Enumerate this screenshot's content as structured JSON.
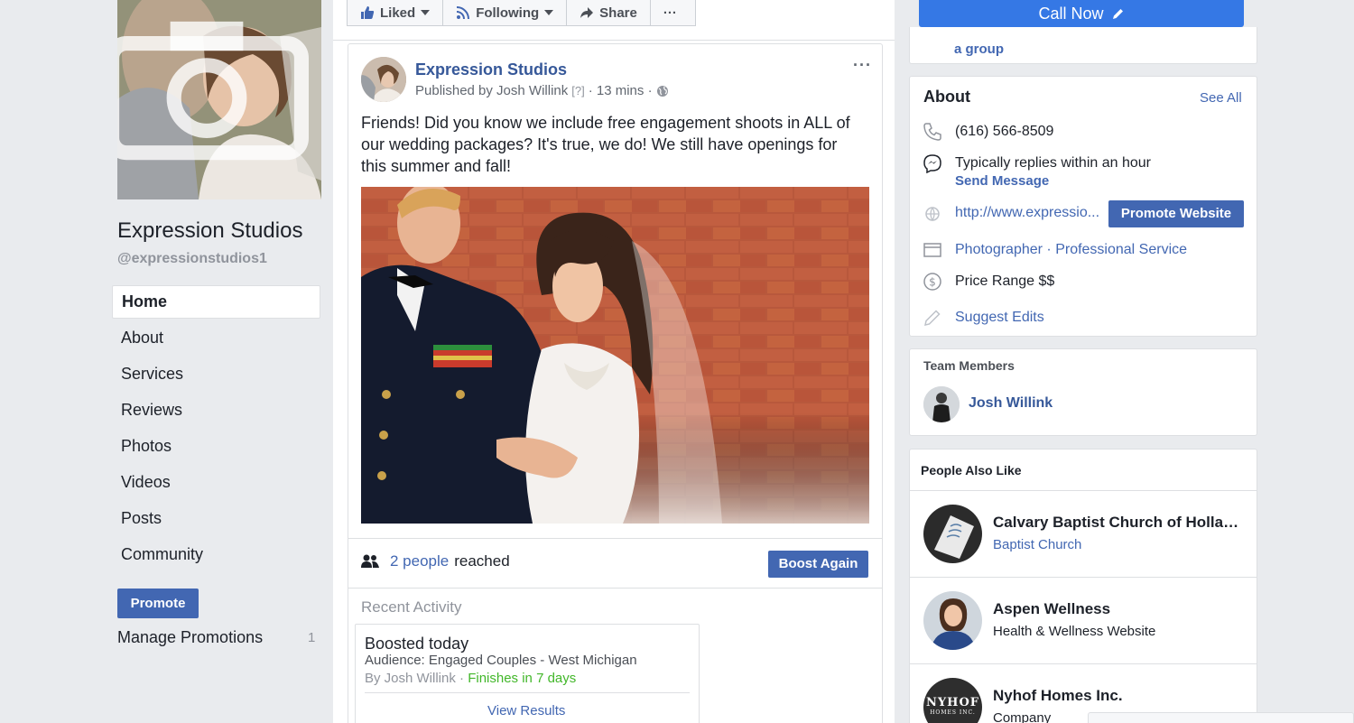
{
  "page": {
    "name": "Expression Studios",
    "handle": "@expressionstudios1"
  },
  "nav": {
    "items": [
      {
        "label": "Home",
        "active": true
      },
      {
        "label": "About"
      },
      {
        "label": "Services"
      },
      {
        "label": "Reviews"
      },
      {
        "label": "Photos"
      },
      {
        "label": "Videos"
      },
      {
        "label": "Posts"
      },
      {
        "label": "Community"
      }
    ],
    "promote_label": "Promote",
    "manage_label": "Manage Promotions",
    "manage_count": "1"
  },
  "action_bar": {
    "liked": "Liked",
    "following": "Following",
    "share": "Share",
    "more": "···"
  },
  "post": {
    "author": "Expression Studios",
    "published_by": "Published by Josh Willink",
    "help": "[?]",
    "time": "· 13 mins ·",
    "more": "···",
    "text": "Friends! Did you know we include free engagement shoots in ALL of our wedding packages? It's true, we do! We still have openings for this summer and fall!",
    "reached_count": "2 people",
    "reached_suffix": "reached",
    "boost_label": "Boost Again",
    "recent_title": "Recent Activity",
    "activity": {
      "title": "Boosted today",
      "audience": "Audience: Engaged Couples - West Michigan",
      "by": "By Josh Willink ·",
      "finishes": "Finishes in 7 days",
      "view_results": "View Results"
    }
  },
  "right": {
    "call_now": "Call Now",
    "group_text": "a group",
    "about": {
      "title": "About",
      "see_all": "See All",
      "phone": "(616) 566-8509",
      "replies": "Typically replies within an hour",
      "send_message": "Send Message",
      "website": "http://www.expressio...",
      "promote_website": "Promote Website",
      "category_1": "Photographer",
      "category_sep": " · ",
      "category_2": "Professional Service",
      "price_range": "Price Range $$",
      "suggest_edits": "Suggest Edits"
    },
    "team": {
      "title": "Team Members",
      "member": "Josh Willink"
    },
    "people_also_like": {
      "title": "People Also Like",
      "items": [
        {
          "name": "Calvary Baptist Church of Hollan...",
          "category": "Baptist Church"
        },
        {
          "name": "Aspen Wellness",
          "category": "Health & Wellness Website"
        },
        {
          "name": "Nyhof Homes Inc.",
          "category": "Company",
          "logo_text": "NYHOF",
          "logo_sub": "HOMES INC."
        }
      ]
    }
  },
  "colors": {
    "brand_blue": "#4267b2",
    "call_blue": "#3578e5",
    "link_blue": "#365899",
    "success_green": "#42b72a",
    "page_bg": "#e9ebee"
  }
}
